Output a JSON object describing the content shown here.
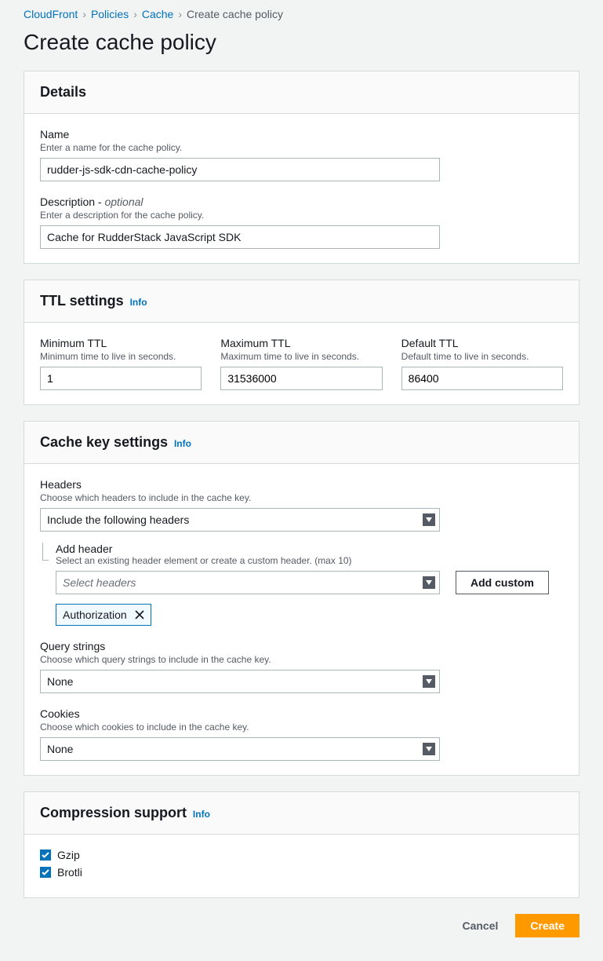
{
  "breadcrumb": {
    "items": [
      "CloudFront",
      "Policies",
      "Cache",
      "Create cache policy"
    ]
  },
  "page_title": "Create cache policy",
  "details": {
    "title": "Details",
    "name": {
      "label": "Name",
      "desc": "Enter a name for the cache policy.",
      "value": "rudder-js-sdk-cdn-cache-policy"
    },
    "description": {
      "label": "Description - ",
      "optional": "optional",
      "desc": "Enter a description for the cache policy.",
      "value": "Cache for RudderStack JavaScript SDK"
    }
  },
  "ttl": {
    "title": "TTL settings",
    "info": "Info",
    "min": {
      "label": "Minimum TTL",
      "desc": "Minimum time to live in seconds.",
      "value": "1"
    },
    "max": {
      "label": "Maximum TTL",
      "desc": "Maximum time to live in seconds.",
      "value": "31536000"
    },
    "def": {
      "label": "Default TTL",
      "desc": "Default time to live in seconds.",
      "value": "86400"
    }
  },
  "cache_key": {
    "title": "Cache key settings",
    "info": "Info",
    "headers": {
      "label": "Headers",
      "desc": "Choose which headers to include in the cache key.",
      "value": "Include the following headers",
      "add_header": {
        "label": "Add header",
        "desc": "Select an existing header element or create a custom header. (max 10)",
        "placeholder": "Select headers",
        "add_custom_btn": "Add custom",
        "token": "Authorization"
      }
    },
    "query_strings": {
      "label": "Query strings",
      "desc": "Choose which query strings to include in the cache key.",
      "value": "None"
    },
    "cookies": {
      "label": "Cookies",
      "desc": "Choose which cookies to include in the cache key.",
      "value": "None"
    }
  },
  "compression": {
    "title": "Compression support",
    "info": "Info",
    "gzip": "Gzip",
    "brotli": "Brotli"
  },
  "footer": {
    "cancel": "Cancel",
    "create": "Create"
  }
}
